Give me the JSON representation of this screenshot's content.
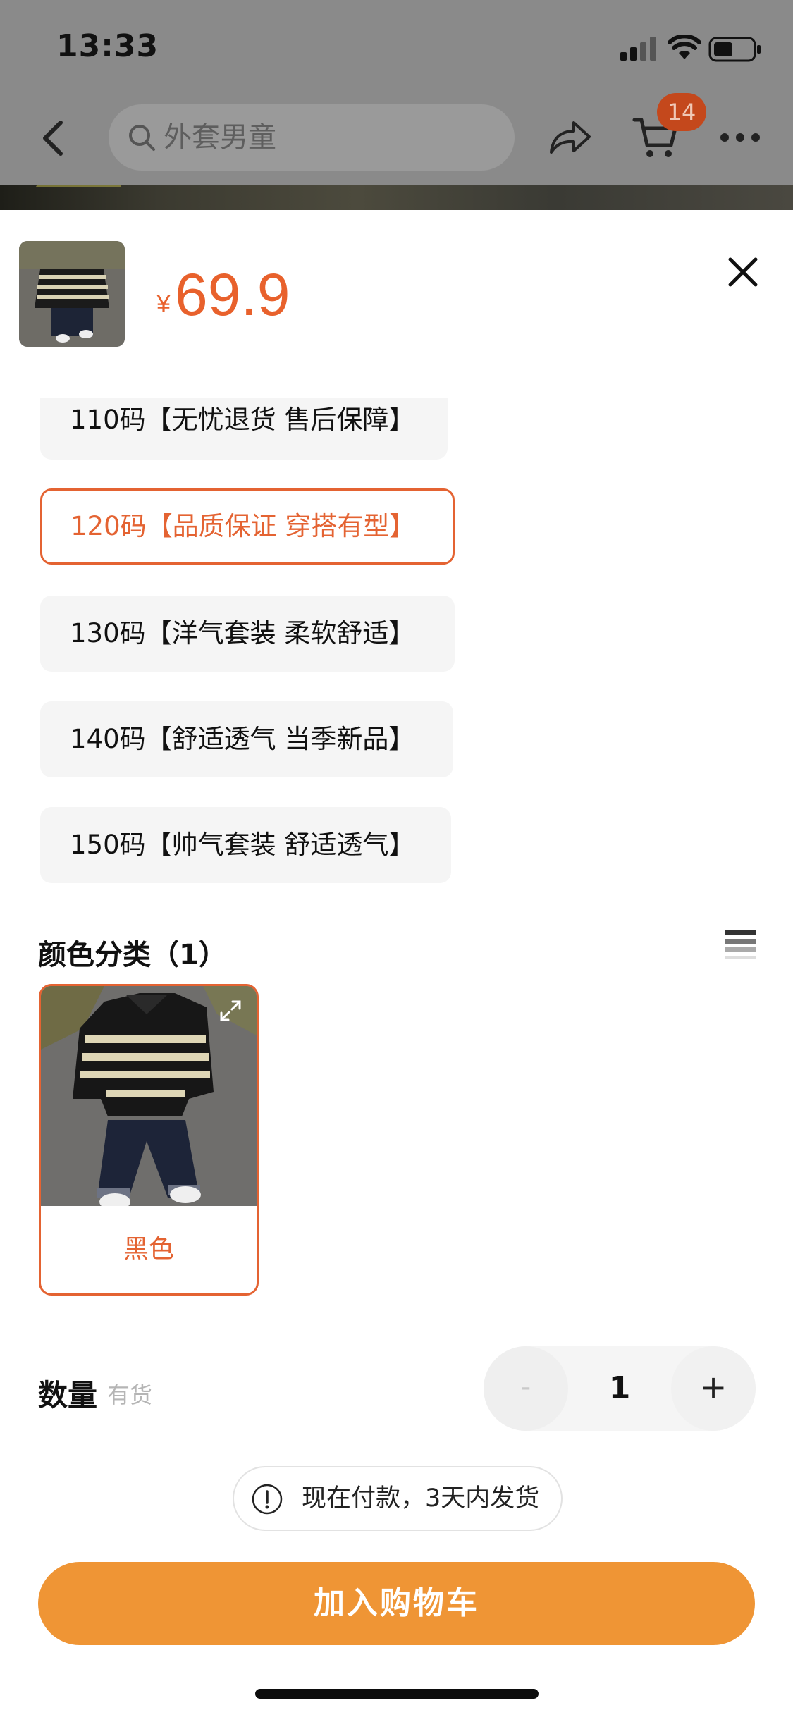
{
  "status_bar": {
    "time": "13:33"
  },
  "nav": {
    "search_placeholder": "外套男童",
    "cart_badge": "14"
  },
  "product": {
    "currency": "¥",
    "price": "69.9"
  },
  "size_options": [
    {
      "label": "110码【无忧退货 售后保障】",
      "selected": false
    },
    {
      "label": "120码【品质保证 穿搭有型】",
      "selected": true
    },
    {
      "label": "130码【洋气套装 柔软舒适】",
      "selected": false
    },
    {
      "label": "140码【舒适透气 当季新品】",
      "selected": false
    },
    {
      "label": "150码【帅气套装 舒适透气】",
      "selected": false
    }
  ],
  "color_section": {
    "title": "颜色分类（1）",
    "options": [
      {
        "label": "黑色",
        "selected": true
      }
    ]
  },
  "quantity": {
    "label": "数量",
    "stock": "有货",
    "minus": "-",
    "value": "1",
    "plus": "+"
  },
  "notice": {
    "text": "现在付款，3天内发货"
  },
  "cta": {
    "label": "加入购物车"
  },
  "colors": {
    "accent": "#e46332",
    "button": "#ef9535",
    "price": "#e8612c"
  }
}
